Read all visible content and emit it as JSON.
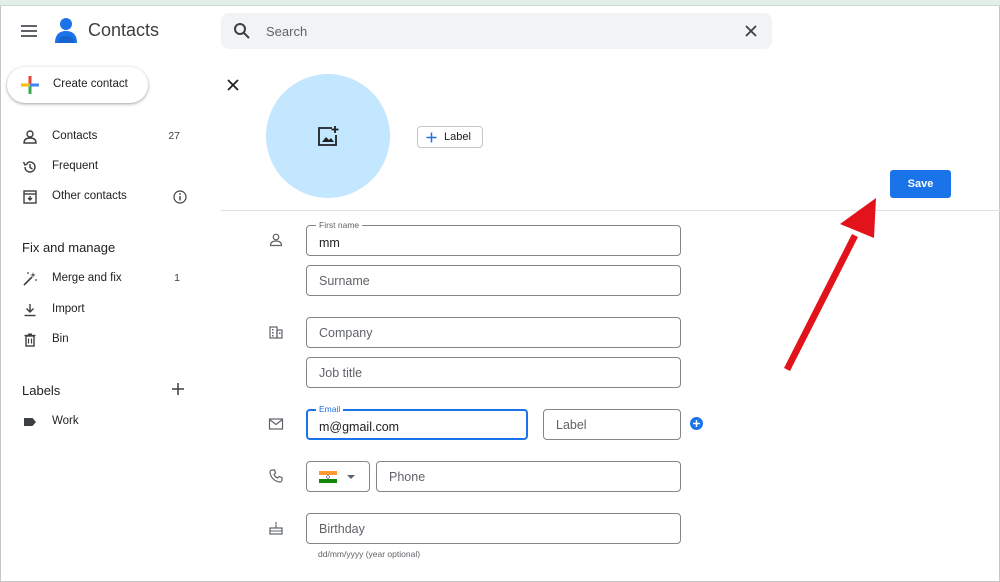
{
  "app": {
    "title": "Contacts"
  },
  "search": {
    "placeholder": "Search",
    "value": ""
  },
  "sidebar": {
    "create_label": "Create contact",
    "items": [
      {
        "label": "Contacts",
        "count": "27",
        "icon": "person-icon"
      },
      {
        "label": "Frequent",
        "icon": "history-icon"
      },
      {
        "label": "Other contacts",
        "icon": "archive-icon",
        "info_icon": "info-icon"
      }
    ],
    "fix_title": "Fix and manage",
    "fix_items": [
      {
        "label": "Merge and fix",
        "count": "1",
        "icon": "magic-wand-icon"
      },
      {
        "label": "Import",
        "icon": "download-icon"
      },
      {
        "label": "Bin",
        "icon": "trash-icon"
      }
    ],
    "labels_title": "Labels",
    "label_items": [
      {
        "label": "Work",
        "icon": "label-tag-icon"
      }
    ]
  },
  "form": {
    "label_chip": "Label",
    "save_label": "Save",
    "first_name": {
      "label": "First name",
      "value": "mm"
    },
    "surname": {
      "placeholder": "Surname",
      "value": ""
    },
    "company": {
      "placeholder": "Company",
      "value": ""
    },
    "job_title": {
      "placeholder": "Job title",
      "value": ""
    },
    "email": {
      "label": "Email",
      "value": "m@gmail.com"
    },
    "email_label": {
      "placeholder": "Label",
      "value": ""
    },
    "phone": {
      "placeholder": "Phone",
      "value": ""
    },
    "birthday": {
      "placeholder": "Birthday",
      "value": "",
      "hint": "dd/mm/yyyy (year optional)"
    }
  },
  "colors": {
    "accent": "#1a73e8",
    "avatar_bg": "#c2e7ff",
    "annotation_arrow": "#e3131b"
  }
}
